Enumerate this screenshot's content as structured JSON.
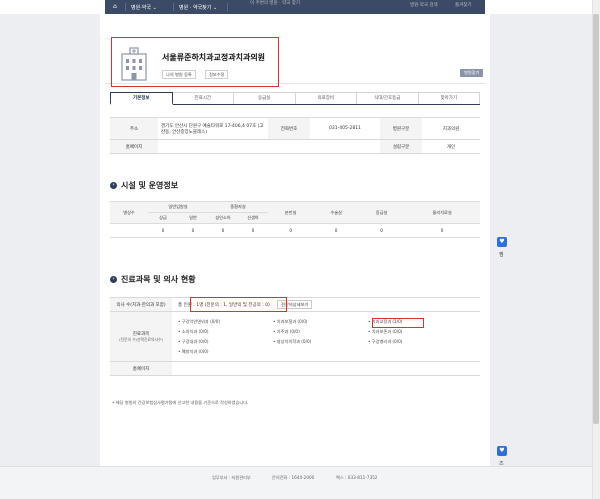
{
  "topbar": {
    "home_icon": "home-icon",
    "nav_items": [
      "병원·약국 ⌄",
      "병원 · 약국찾기 ⌄"
    ],
    "mid_text": "이 주변의 병원 · 약국 찾기",
    "right_items": [
      "병원·약국 검색",
      "즐겨찾기"
    ]
  },
  "hospital": {
    "name": "서울류준하치과교정과치과의원",
    "chip_register": "나의 병원 등록",
    "chip_edit": "정보수정",
    "find_label": "병원찾기"
  },
  "tabs": [
    "기본정보",
    "진료시간",
    "응급실",
    "의료장비",
    "식대/간호등급",
    "찾아가기"
  ],
  "info": {
    "addr_label": "주소",
    "addr_value": "경기도 안산시 단원구 예술타워로 17-406,4 07호 (고잔동, 안산중앙노블레스)",
    "phone_label": "전화번호",
    "phone_value": "031-405-2811",
    "type_label": "병원구분",
    "type_value": "치과의원",
    "homepage_label": "홈페이지",
    "homepage_value": "",
    "est_label": "설립구분",
    "est_value": "개인"
  },
  "facility": {
    "title": "시설 및 운영정보",
    "beds_label": "병상수",
    "general_label": "일반입원실",
    "intensive_label": "중환자실",
    "sub_headers": [
      "상급",
      "일반",
      "성인소아",
      "신생아"
    ],
    "cols": [
      "분만실",
      "수술실",
      "응급실",
      "물리치료실"
    ],
    "values": [
      "0",
      "0",
      "0",
      "0",
      "0",
      "0",
      "0",
      "0"
    ]
  },
  "doctors": {
    "title": "진료과목 및 의사 현황",
    "count_label": "의사 수(치과·한의과 포함)",
    "count_value": "총 인원 : 1명 (전문의 : 1, 일반의 및 전공의 : 0)",
    "view_btn": "전문의상세보기",
    "dept_label": "진료과목",
    "dept_sub": "(전문의 수/선택진료의사수)",
    "depts": [
      "• 구강악안면외과 (0/0)",
      "• 치과보철과 (0/0)",
      "• 치과교정과 (1/0)",
      "• 소아치과 (0/0)",
      "• 치주과 (0/0)",
      "• 치과보존과 (0/0)",
      "• 구강내과 (0/0)",
      "• 영상치의학과 (0/0)",
      "• 구강병리과 (0/0)",
      "• 예방치과 (0/0)"
    ],
    "homepage_label": "홈페이지"
  },
  "notice": "• 해당 병원의 건강보험심사평가원에 신고한 내용을 기준으로 작성하였습니다.",
  "footer": {
    "dept": "업무부서 : 자원관리부",
    "inquiry": "문의전화 : 1644-2000",
    "fax": "팩스 : 033-811-7352"
  },
  "side": {
    "label1": "찜",
    "label2": "즈"
  }
}
